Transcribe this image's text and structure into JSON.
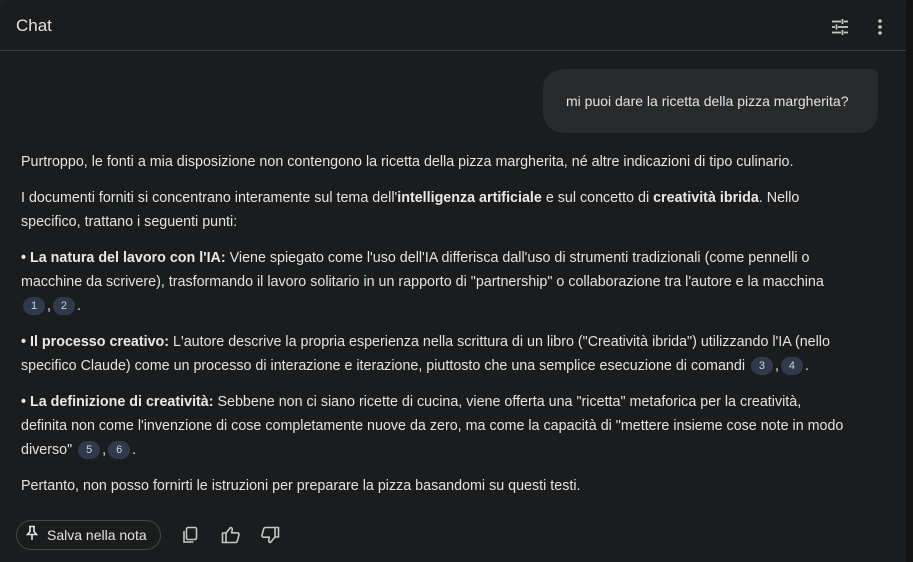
{
  "header": {
    "title": "Chat",
    "tune_icon": "tune-icon",
    "more_icon": "more-vert-icon"
  },
  "user_message": {
    "text": "mi puoi dare la ricetta della pizza margherita?"
  },
  "answer": {
    "p1": "Purtroppo, le fonti a mia disposizione non contengono la ricetta della pizza margherita, né altre indicazioni di tipo culinario.",
    "p2": {
      "a": "I documenti forniti si concentrano interamente sul tema dell'",
      "b": "intelligenza artificiale",
      "c": " e sul concetto di ",
      "d": "creatività ibrida",
      "e": ". Nello specifico, trattano i seguenti punti:"
    },
    "bullet1": {
      "marker": "•",
      "title": "La natura del lavoro con l'IA:",
      "text": " Viene spiegato come l'uso dell'IA differisca dall'uso di strumenti tradizionali (come pennelli o macchine da scrivere), trasformando il lavoro solitario in un rapporto di \"partnership\" o collaborazione tra l'autore e la macchina",
      "cites": [
        "1",
        "2"
      ],
      "end": "."
    },
    "bullet2": {
      "marker": "•",
      "title": "Il processo creativo:",
      "text": " L'autore descrive la propria esperienza nella scrittura di un libro (\"Creatività ibrida\") utilizzando l'IA (nello specifico Claude) come un processo di interazione e iterazione, piuttosto che una semplice esecuzione di comandi",
      "cites": [
        "3",
        "4"
      ],
      "end": "."
    },
    "bullet3": {
      "marker": "•",
      "title": "La definizione di creatività:",
      "text": " Sebbene non ci siano ricette di cucina, viene offerta una \"ricetta\" metaforica per la creatività, definita non come l'invenzione di cose completamente nuove da zero, ma come la capacità di \"mettere insieme cose note in modo diverso\"",
      "cites": [
        "5",
        "6"
      ],
      "end": "."
    },
    "p_last": "Pertanto, non posso fornirti le istruzioni per preparare la pizza basandomi su questi testi."
  },
  "actions": {
    "save_label": "Salva nella nota",
    "pin_icon": "pin-icon",
    "copy_icon": "copy-icon",
    "thumb_up_icon": "thumb-up-icon",
    "thumb_down_icon": "thumb-down-icon"
  },
  "colors": {
    "background": "#1b1c1d",
    "user_bubble": "#282a2c",
    "citation_chip": "#2f3a4d",
    "text": "#e3e3e3"
  }
}
